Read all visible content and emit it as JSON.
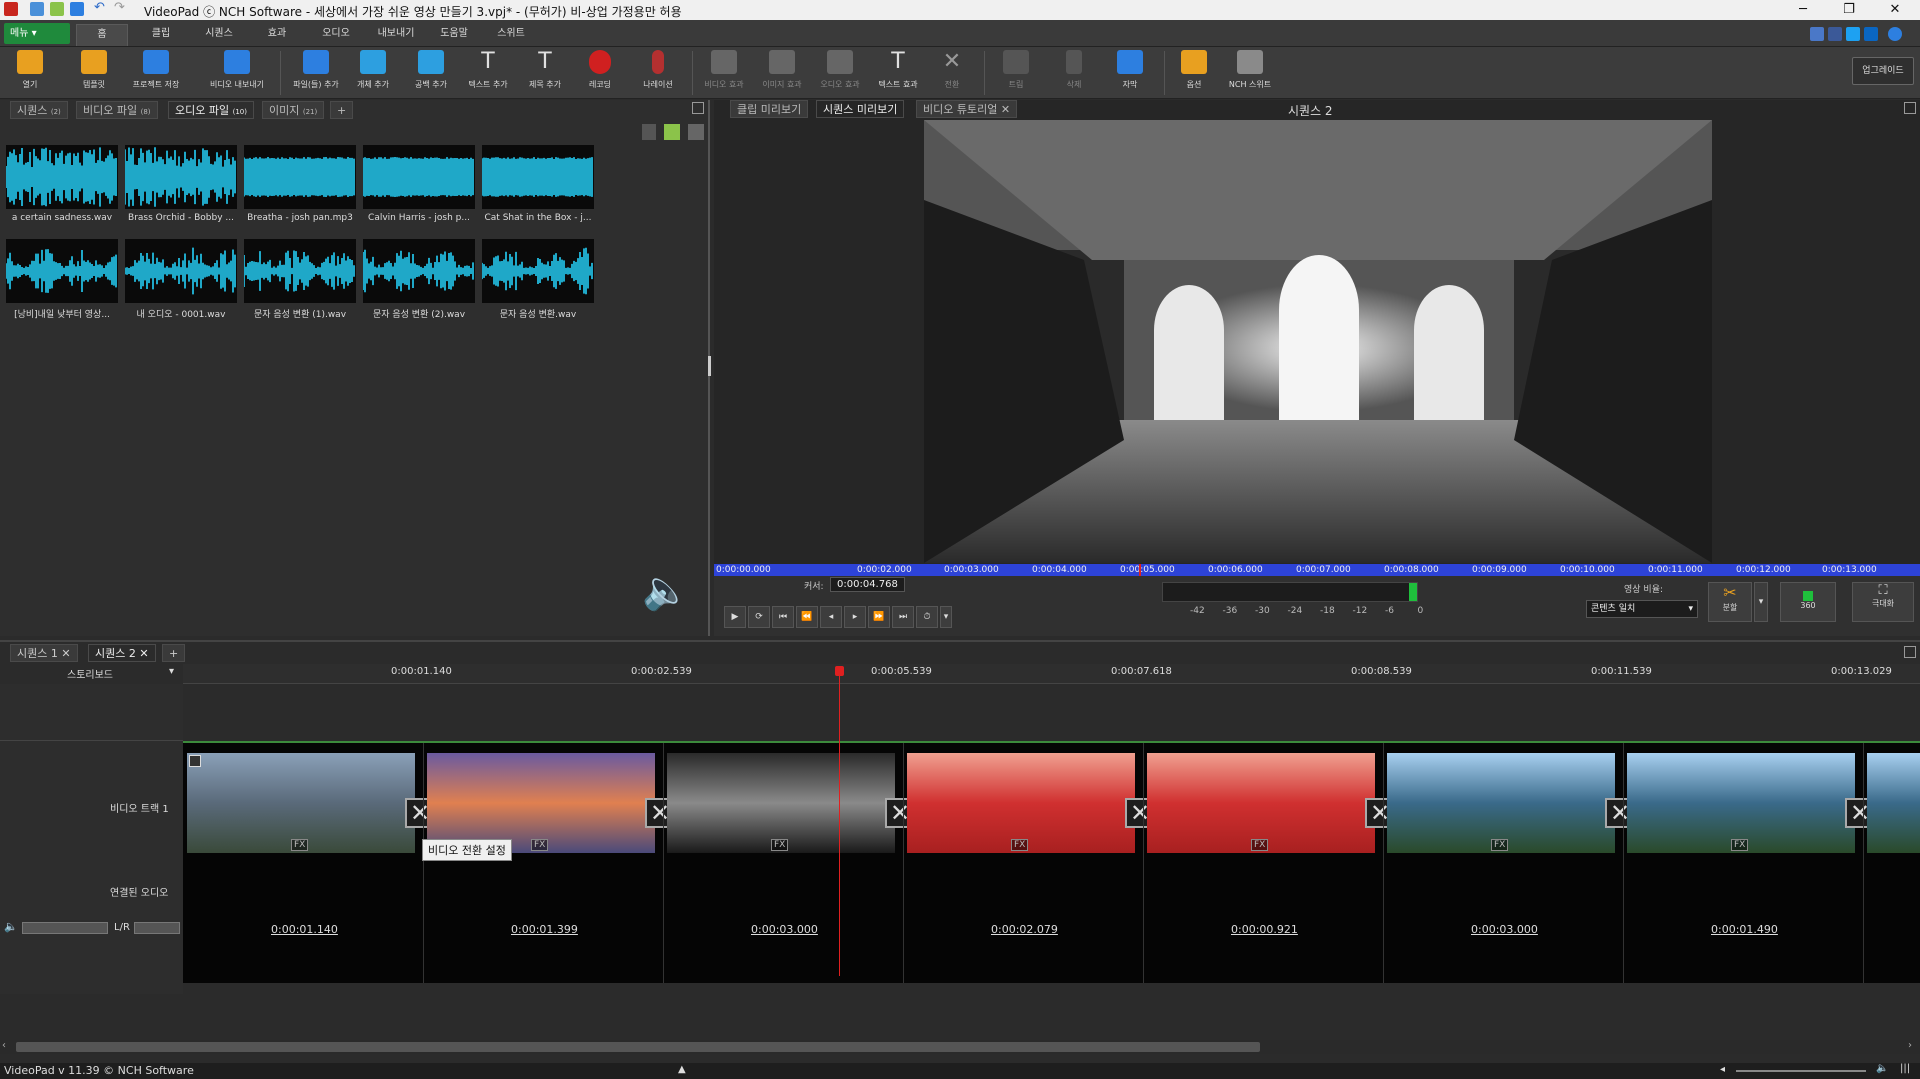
{
  "window": {
    "title": "VideoPad ⓒ NCH Software - 세상에서 가장 쉬운 영상 만들기 3.vpj* - (무허가) 비-상업 가정용만 허용",
    "minimize": "─",
    "maximize": "❐",
    "close": "✕"
  },
  "menu": {
    "menu_button": "메뉴 ▾",
    "tabs": [
      "홈",
      "클립",
      "시퀀스",
      "효과",
      "오디오",
      "내보내기",
      "도움말",
      "스위트"
    ]
  },
  "toolbar": {
    "items": [
      {
        "label": "열기",
        "color": "#e8a020"
      },
      {
        "label": "템플릿",
        "color": "#e8a020"
      },
      {
        "label": "프로젝트 저장",
        "color": "#2d7fe0"
      },
      {
        "label": "비디오 내보내기",
        "color": "#2d7fe0"
      },
      {
        "label": "파일(들) 추가",
        "color": "#2d7fe0"
      },
      {
        "label": "개체 추가",
        "color": "#2d9fe0"
      },
      {
        "label": "공백 추가",
        "color": "#2d9fe0"
      },
      {
        "label": "텍스트 추가",
        "color": "#cfcfcf"
      },
      {
        "label": "제목 추가",
        "color": "#cfcfcf"
      },
      {
        "label": "레코딩",
        "color": "#d02020"
      },
      {
        "label": "나레이션",
        "color": "#d02020"
      },
      {
        "label": "비디오 효과",
        "color": "#777"
      },
      {
        "label": "이미지 효과",
        "color": "#777"
      },
      {
        "label": "오디오 효과",
        "color": "#777"
      },
      {
        "label": "텍스트 효과",
        "color": "#cfcfcf"
      },
      {
        "label": "전환",
        "color": "#777"
      },
      {
        "label": "트림",
        "color": "#777"
      },
      {
        "label": "삭제",
        "color": "#777"
      },
      {
        "label": "자막",
        "color": "#2d7fe0"
      },
      {
        "label": "옵션",
        "color": "#e8a020"
      },
      {
        "label": "NCH 스위트",
        "color": "#cfcfcf"
      }
    ],
    "upgrade": "업그레이드"
  },
  "bin": {
    "tabs": [
      {
        "label": "시퀀스",
        "count": "(2)"
      },
      {
        "label": "비디오 파일",
        "count": "(8)"
      },
      {
        "label": "오디오 파일",
        "count": "(10)"
      },
      {
        "label": "이미지",
        "count": "(21)"
      }
    ],
    "add_tab": "+",
    "files": [
      "a certain sadness.wav",
      "Brass Orchid - Bobby ...",
      "Breatha - josh pan.mp3",
      "Calvin Harris - josh p...",
      "Cat Shat in the Box - j...",
      "[낭비]내일 낮부터 영상...",
      "내 오디오 - 0001.wav",
      "문자 음성 변환 (1).wav",
      "문자 음성 변환 (2).wav",
      "문자 음성 변환.wav"
    ]
  },
  "preview": {
    "tabs": [
      "클립 미리보기",
      "시퀀스 미리보기",
      "비디오 튜토리얼"
    ],
    "close": "✕",
    "sequence_title": "시퀀스 2",
    "ruler": [
      "0:00:00.000",
      "0:00:02.000",
      "0:00:03.000",
      "0:00:04.000",
      "0:00:05.000",
      "0:00:06.000",
      "0:00:07.000",
      "0:00:08.000",
      "0:00:09.000",
      "0:00:10.000",
      "0:00:11.000",
      "0:00:12.000",
      "0:00:13.000"
    ],
    "cursor_label": "커서:",
    "cursor_value": "0:00:04.768",
    "meter_labels": [
      "-42",
      "-36",
      "-30",
      "-24",
      "-18",
      "-12",
      "-6",
      "0"
    ],
    "ratio_label": "영상 비율:",
    "ratio_value": "콘텐츠 일치",
    "split_label": "분할",
    "vr_label": "360",
    "fullscreen_label": "극대화"
  },
  "timeline": {
    "tabs": [
      "시퀀스 1",
      "시퀀스 2"
    ],
    "add_tab": "+",
    "view_mode": "스토리보드",
    "ruler": [
      "0:00:01.140",
      "0:00:02.539",
      "0:00:05.539",
      "0:00:07.618",
      "0:00:08.539",
      "0:00:11.539",
      "0:00:13.029"
    ],
    "video_track": "비디오 트랙 1",
    "linked_audio": "연결된 오디오",
    "lr": "L/R",
    "tooltip": "비디오 전환 설정",
    "fx": "FX",
    "durations": [
      "0:00:01.140",
      "0:00:01.399",
      "0:00:03.000",
      "0:00:02.079",
      "0:00:00.921",
      "0:00:03.000",
      "0:00:01.490"
    ]
  },
  "status": {
    "version": "VideoPad v 11.39 © NCH Software"
  }
}
